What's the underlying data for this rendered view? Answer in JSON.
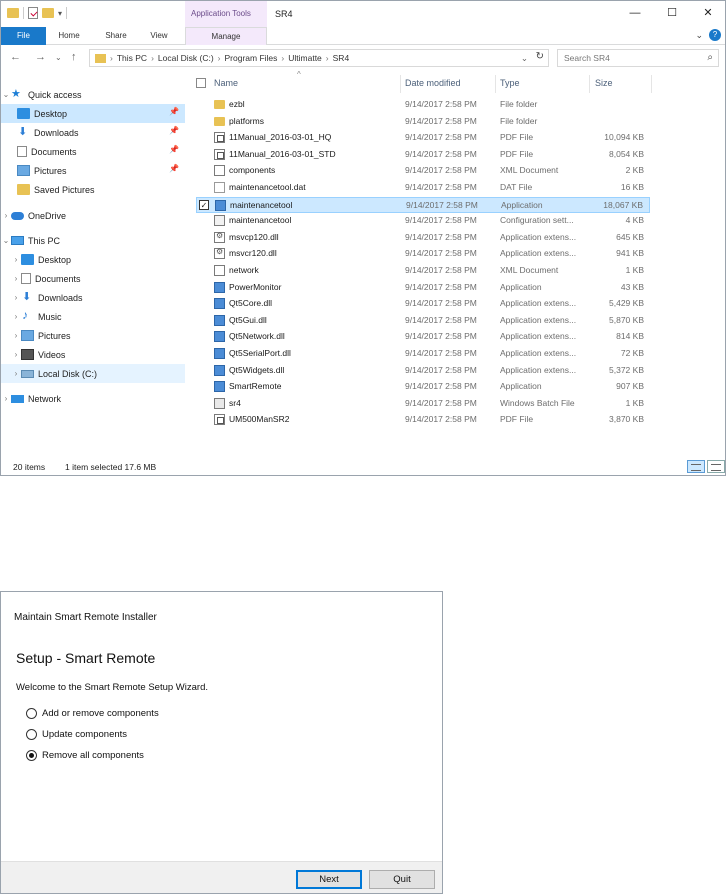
{
  "explorer": {
    "title": "SR4",
    "context_tab": "Application Tools",
    "window_controls": {
      "minimize": "—",
      "maximize": "☐",
      "close": "✕"
    },
    "ribbon_tabs": [
      "File",
      "Home",
      "Share",
      "View",
      "Manage"
    ],
    "ribbon_expand": "⌄",
    "help": "?",
    "nav_buttons": {
      "back": "←",
      "forward": "→",
      "recent": "⌄",
      "up": "↑"
    },
    "breadcrumb": [
      "This PC",
      "Local Disk (C:)",
      "Program Files",
      "Ultimatte",
      "SR4"
    ],
    "search_placeholder": "Search SR4",
    "columns": {
      "name": "Name",
      "date": "Date modified",
      "type": "Type",
      "size": "Size"
    },
    "nav": [
      {
        "label": "Quick access",
        "icon": "star-icon"
      },
      {
        "label": "Desktop",
        "icon": "desktop-icon",
        "pinned": true
      },
      {
        "label": "Downloads",
        "icon": "downloads-icon",
        "pinned": true
      },
      {
        "label": "Documents",
        "icon": "documents-icon",
        "pinned": true
      },
      {
        "label": "Pictures",
        "icon": "pictures-icon",
        "pinned": true
      },
      {
        "label": "Saved Pictures",
        "icon": "folder-icon"
      },
      {
        "label": "OneDrive",
        "icon": "onedrive-icon"
      },
      {
        "label": "This PC",
        "icon": "this-pc-icon"
      },
      {
        "label": "Desktop",
        "icon": "desktop-icon"
      },
      {
        "label": "Documents",
        "icon": "documents-icon"
      },
      {
        "label": "Downloads",
        "icon": "downloads-icon"
      },
      {
        "label": "Music",
        "icon": "music-icon"
      },
      {
        "label": "Pictures",
        "icon": "pictures-icon"
      },
      {
        "label": "Videos",
        "icon": "videos-icon"
      },
      {
        "label": "Local Disk (C:)",
        "icon": "disk-icon"
      },
      {
        "label": "Network",
        "icon": "network-icon"
      }
    ],
    "files": [
      {
        "name": "ezbl",
        "date": "9/14/2017 2:58 PM",
        "type": "File folder",
        "size": "",
        "kind": "folder"
      },
      {
        "name": "platforms",
        "date": "9/14/2017 2:58 PM",
        "type": "File folder",
        "size": "",
        "kind": "folder"
      },
      {
        "name": "11Manual_2016-03-01_HQ",
        "date": "9/14/2017 2:58 PM",
        "type": "PDF File",
        "size": "10,094 KB",
        "kind": "pdf"
      },
      {
        "name": "11Manual_2016-03-01_STD",
        "date": "9/14/2017 2:58 PM",
        "type": "PDF File",
        "size": "8,054 KB",
        "kind": "pdf"
      },
      {
        "name": "components",
        "date": "9/14/2017 2:58 PM",
        "type": "XML Document",
        "size": "2 KB",
        "kind": "xml"
      },
      {
        "name": "maintenancetool.dat",
        "date": "9/14/2017 2:58 PM",
        "type": "DAT File",
        "size": "16 KB",
        "kind": "dat"
      },
      {
        "name": "maintenancetool",
        "date": "9/14/2017 2:58 PM",
        "type": "Application",
        "size": "18,067 KB",
        "kind": "app",
        "selected": true
      },
      {
        "name": "maintenancetool",
        "date": "9/14/2017 2:58 PM",
        "type": "Configuration sett...",
        "size": "4 KB",
        "kind": "cfg"
      },
      {
        "name": "msvcp120.dll",
        "date": "9/14/2017 2:58 PM",
        "type": "Application extens...",
        "size": "645 KB",
        "kind": "dll"
      },
      {
        "name": "msvcr120.dll",
        "date": "9/14/2017 2:58 PM",
        "type": "Application extens...",
        "size": "941 KB",
        "kind": "dll"
      },
      {
        "name": "network",
        "date": "9/14/2017 2:58 PM",
        "type": "XML Document",
        "size": "1 KB",
        "kind": "xml"
      },
      {
        "name": "PowerMonitor",
        "date": "9/14/2017 2:58 PM",
        "type": "Application",
        "size": "43 KB",
        "kind": "app"
      },
      {
        "name": "Qt5Core.dll",
        "date": "9/14/2017 2:58 PM",
        "type": "Application extens...",
        "size": "5,429 KB",
        "kind": "qt"
      },
      {
        "name": "Qt5Gui.dll",
        "date": "9/14/2017 2:58 PM",
        "type": "Application extens...",
        "size": "5,870 KB",
        "kind": "qt"
      },
      {
        "name": "Qt5Network.dll",
        "date": "9/14/2017 2:58 PM",
        "type": "Application extens...",
        "size": "814 KB",
        "kind": "qt"
      },
      {
        "name": "Qt5SerialPort.dll",
        "date": "9/14/2017 2:58 PM",
        "type": "Application extens...",
        "size": "72 KB",
        "kind": "qt"
      },
      {
        "name": "Qt5Widgets.dll",
        "date": "9/14/2017 2:58 PM",
        "type": "Application extens...",
        "size": "5,372 KB",
        "kind": "qt"
      },
      {
        "name": "SmartRemote",
        "date": "9/14/2017 2:58 PM",
        "type": "Application",
        "size": "907 KB",
        "kind": "app"
      },
      {
        "name": "sr4",
        "date": "9/14/2017 2:58 PM",
        "type": "Windows Batch File",
        "size": "1 KB",
        "kind": "bat"
      },
      {
        "name": "UM500ManSR2",
        "date": "9/14/2017 2:58 PM",
        "type": "PDF File",
        "size": "3,870 KB",
        "kind": "pdf"
      }
    ],
    "status": {
      "items": "20 items",
      "selection": "1 item selected  17.6 MB"
    },
    "colors": {
      "accent": "#1979ca",
      "selection": "#cce8ff",
      "folder": "#e8c254",
      "context": "#f4e9fb"
    }
  },
  "installer": {
    "title": "Maintain Smart Remote Installer",
    "heading": "Setup - Smart Remote",
    "welcome": "Welcome to the Smart Remote Setup Wizard.",
    "options": [
      {
        "label": "Add or remove components",
        "selected": false
      },
      {
        "label": "Update components",
        "selected": false
      },
      {
        "label": "Remove all components",
        "selected": true
      }
    ],
    "buttons": {
      "next": "Next",
      "quit": "Quit"
    }
  }
}
